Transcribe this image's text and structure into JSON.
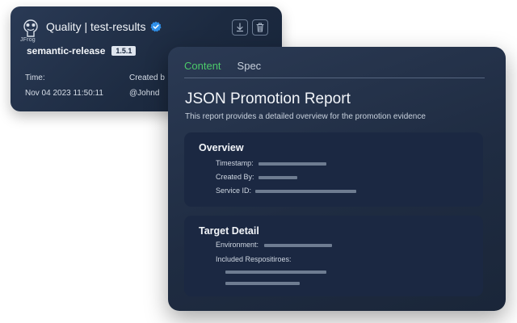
{
  "evidence_card": {
    "logo_text": "JFrog",
    "title": "Quality | test-results",
    "package_name": "semantic-release",
    "version": "1.5.1",
    "time_label": "Time:",
    "time_value": "Nov 04 2023  11:50:11",
    "created_by_label": "Created b",
    "created_by_value": "@Johnd",
    "icons": [
      "jfrog-logo",
      "verified-icon",
      "download-icon",
      "trash-icon"
    ]
  },
  "report": {
    "tabs": [
      {
        "label": "Content",
        "active": true
      },
      {
        "label": "Spec",
        "active": false
      }
    ],
    "title": "JSON Promotion Report",
    "description": "This report provides a detailed overview for the promotion evidence",
    "overview": {
      "title": "Overview",
      "fields": [
        "Timestamp:",
        "Created By:",
        "Service ID:"
      ]
    },
    "target_detail": {
      "title": "Target Detail",
      "fields": [
        "Environment:",
        "Included Respositiroes:"
      ]
    }
  },
  "colors": {
    "accent_green": "#4cc96a",
    "verified_blue": "#2f8fe8",
    "card_bg": "#1f2c42",
    "section_bg": "#1b2842"
  }
}
